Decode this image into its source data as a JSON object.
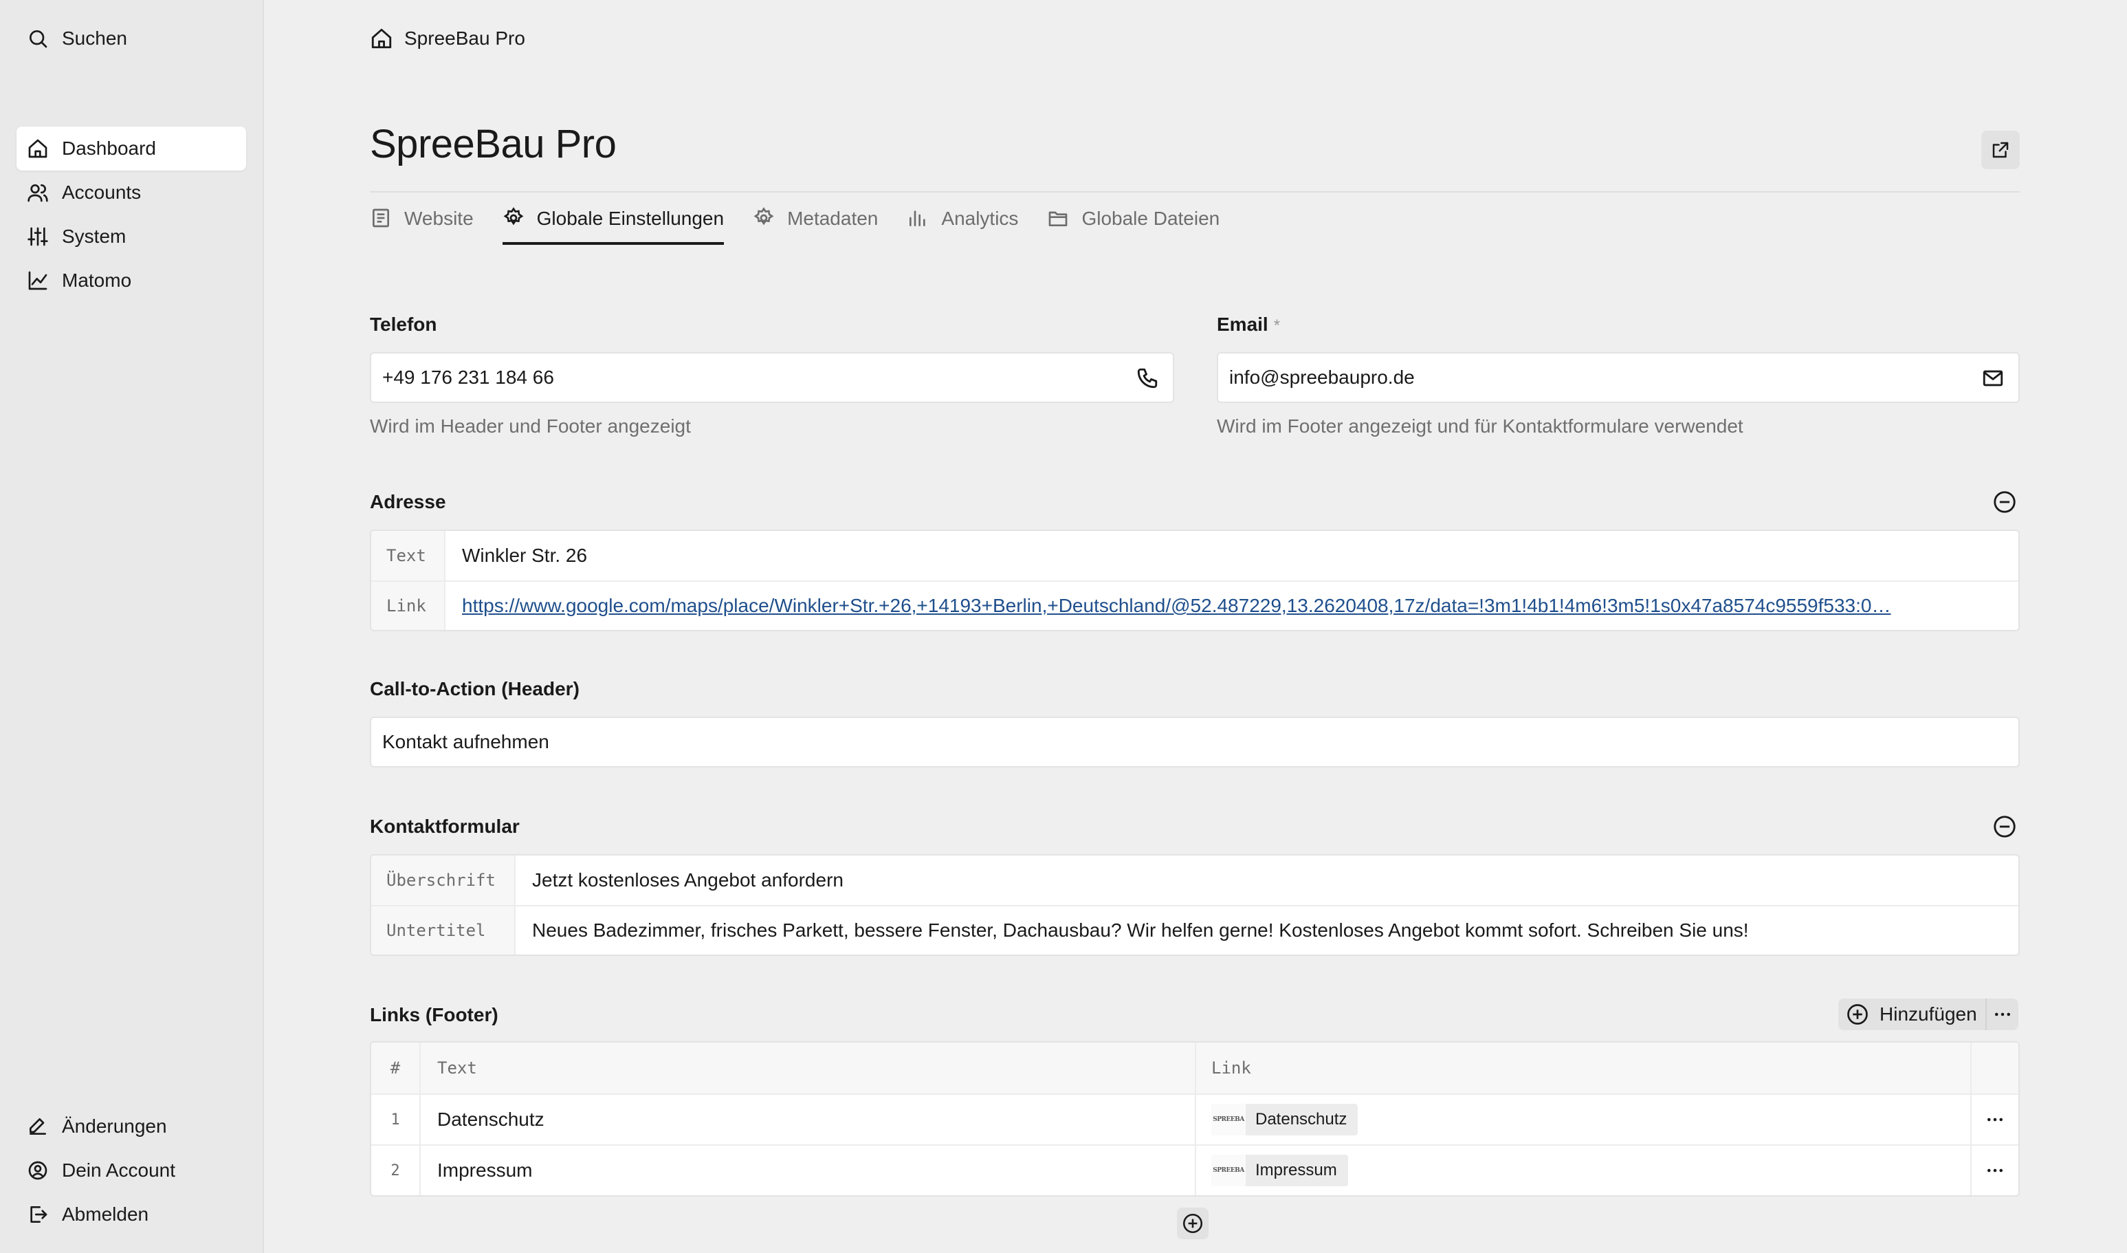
{
  "sidebar": {
    "search_label": "Suchen",
    "nav": [
      {
        "label": "Dashboard",
        "icon": "home-icon",
        "active": true
      },
      {
        "label": "Accounts",
        "icon": "users-icon"
      },
      {
        "label": "System",
        "icon": "sliders-icon"
      },
      {
        "label": "Matomo",
        "icon": "line-chart-icon"
      }
    ],
    "footer": [
      {
        "label": "Änderungen",
        "icon": "pencil-icon"
      },
      {
        "label": "Dein Account",
        "icon": "user-circle-icon"
      },
      {
        "label": "Abmelden",
        "icon": "logout-icon"
      }
    ]
  },
  "breadcrumb": {
    "label": "SpreeBau Pro"
  },
  "page": {
    "title": "SpreeBau Pro"
  },
  "tabs": [
    {
      "label": "Website",
      "icon": "page-icon"
    },
    {
      "label": "Globale Einstellungen",
      "icon": "settings-icon",
      "active": true
    },
    {
      "label": "Metadaten",
      "icon": "settings-icon"
    },
    {
      "label": "Analytics",
      "icon": "bar-chart-icon"
    },
    {
      "label": "Globale Dateien",
      "icon": "folder-icon"
    }
  ],
  "form": {
    "phone": {
      "label": "Telefon",
      "value": "+49 176 231 184 66",
      "hint": "Wird im Header und Footer angezeigt"
    },
    "email": {
      "label": "Email",
      "required_mark": "*",
      "value": "info@spreebaupro.de",
      "hint": "Wird im Footer angezeigt und für Kontaktformulare verwendet"
    },
    "address": {
      "label": "Adresse",
      "text_key": "Text",
      "text_value": "Winkler Str. 26",
      "link_key": "Link",
      "link_value": "https://www.google.com/maps/place/Winkler+Str.+26,+14193+Berlin,+Deutschland/@52.487229,13.2620408,17z/data=!3m1!4b1!4m6!3m5!1s0x47a8574c9559f533:0…"
    },
    "cta": {
      "label": "Call-to-Action (Header)",
      "value": "Kontakt aufnehmen"
    },
    "contact_form": {
      "label": "Kontaktformular",
      "heading_key": "Überschrift",
      "heading_value": "Jetzt kostenloses Angebot anfordern",
      "subtitle_key": "Untertitel",
      "subtitle_value": "Neues Badezimmer, frisches Parkett, bessere Fenster, Dachausbau? Wir helfen gerne! Kostenloses Angebot kommt sofort. Schreiben Sie uns!"
    },
    "footer_links": {
      "label": "Links (Footer)",
      "add_label": "Hinzufügen",
      "columns": {
        "num": "#",
        "text": "Text",
        "link": "Link"
      },
      "rows": [
        {
          "num": "1",
          "text": "Datenschutz",
          "link_logo": "SPREEBA",
          "link_label": "Datenschutz"
        },
        {
          "num": "2",
          "text": "Impressum",
          "link_logo": "SPREEBA",
          "link_label": "Impressum"
        }
      ]
    }
  }
}
